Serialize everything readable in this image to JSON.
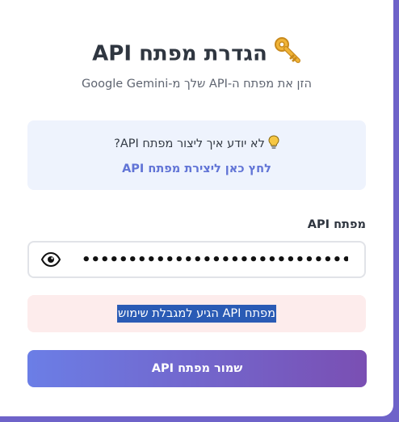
{
  "dialog": {
    "title": "הגדרת מפתח API",
    "subtitle": "הזן את מפתח ה-API שלך מ-Google Gemini",
    "title_icon": "key-icon"
  },
  "info": {
    "question": "לא יודע איך ליצור מפתח API?",
    "question_icon": "lightbulb-icon",
    "link_text": "לחץ כאן ליצירת מפתח API"
  },
  "api_key": {
    "label": "מפתח API",
    "value": "••••••••••••••••••••••••••••••••••••",
    "toggle_icon": "eye-icon"
  },
  "error": {
    "message": "מפתח API הגיע למגבלת שימוש"
  },
  "save_button": {
    "label": "שמור מפתח API"
  },
  "colors": {
    "backdrop": "#6e63c9",
    "link": "#6174d6",
    "info_bg": "#eef3fd",
    "error_bg": "#fdecec",
    "selection": "#2a5bb5",
    "button_start": "#6b7ee6",
    "button_end": "#7a4fb3"
  }
}
